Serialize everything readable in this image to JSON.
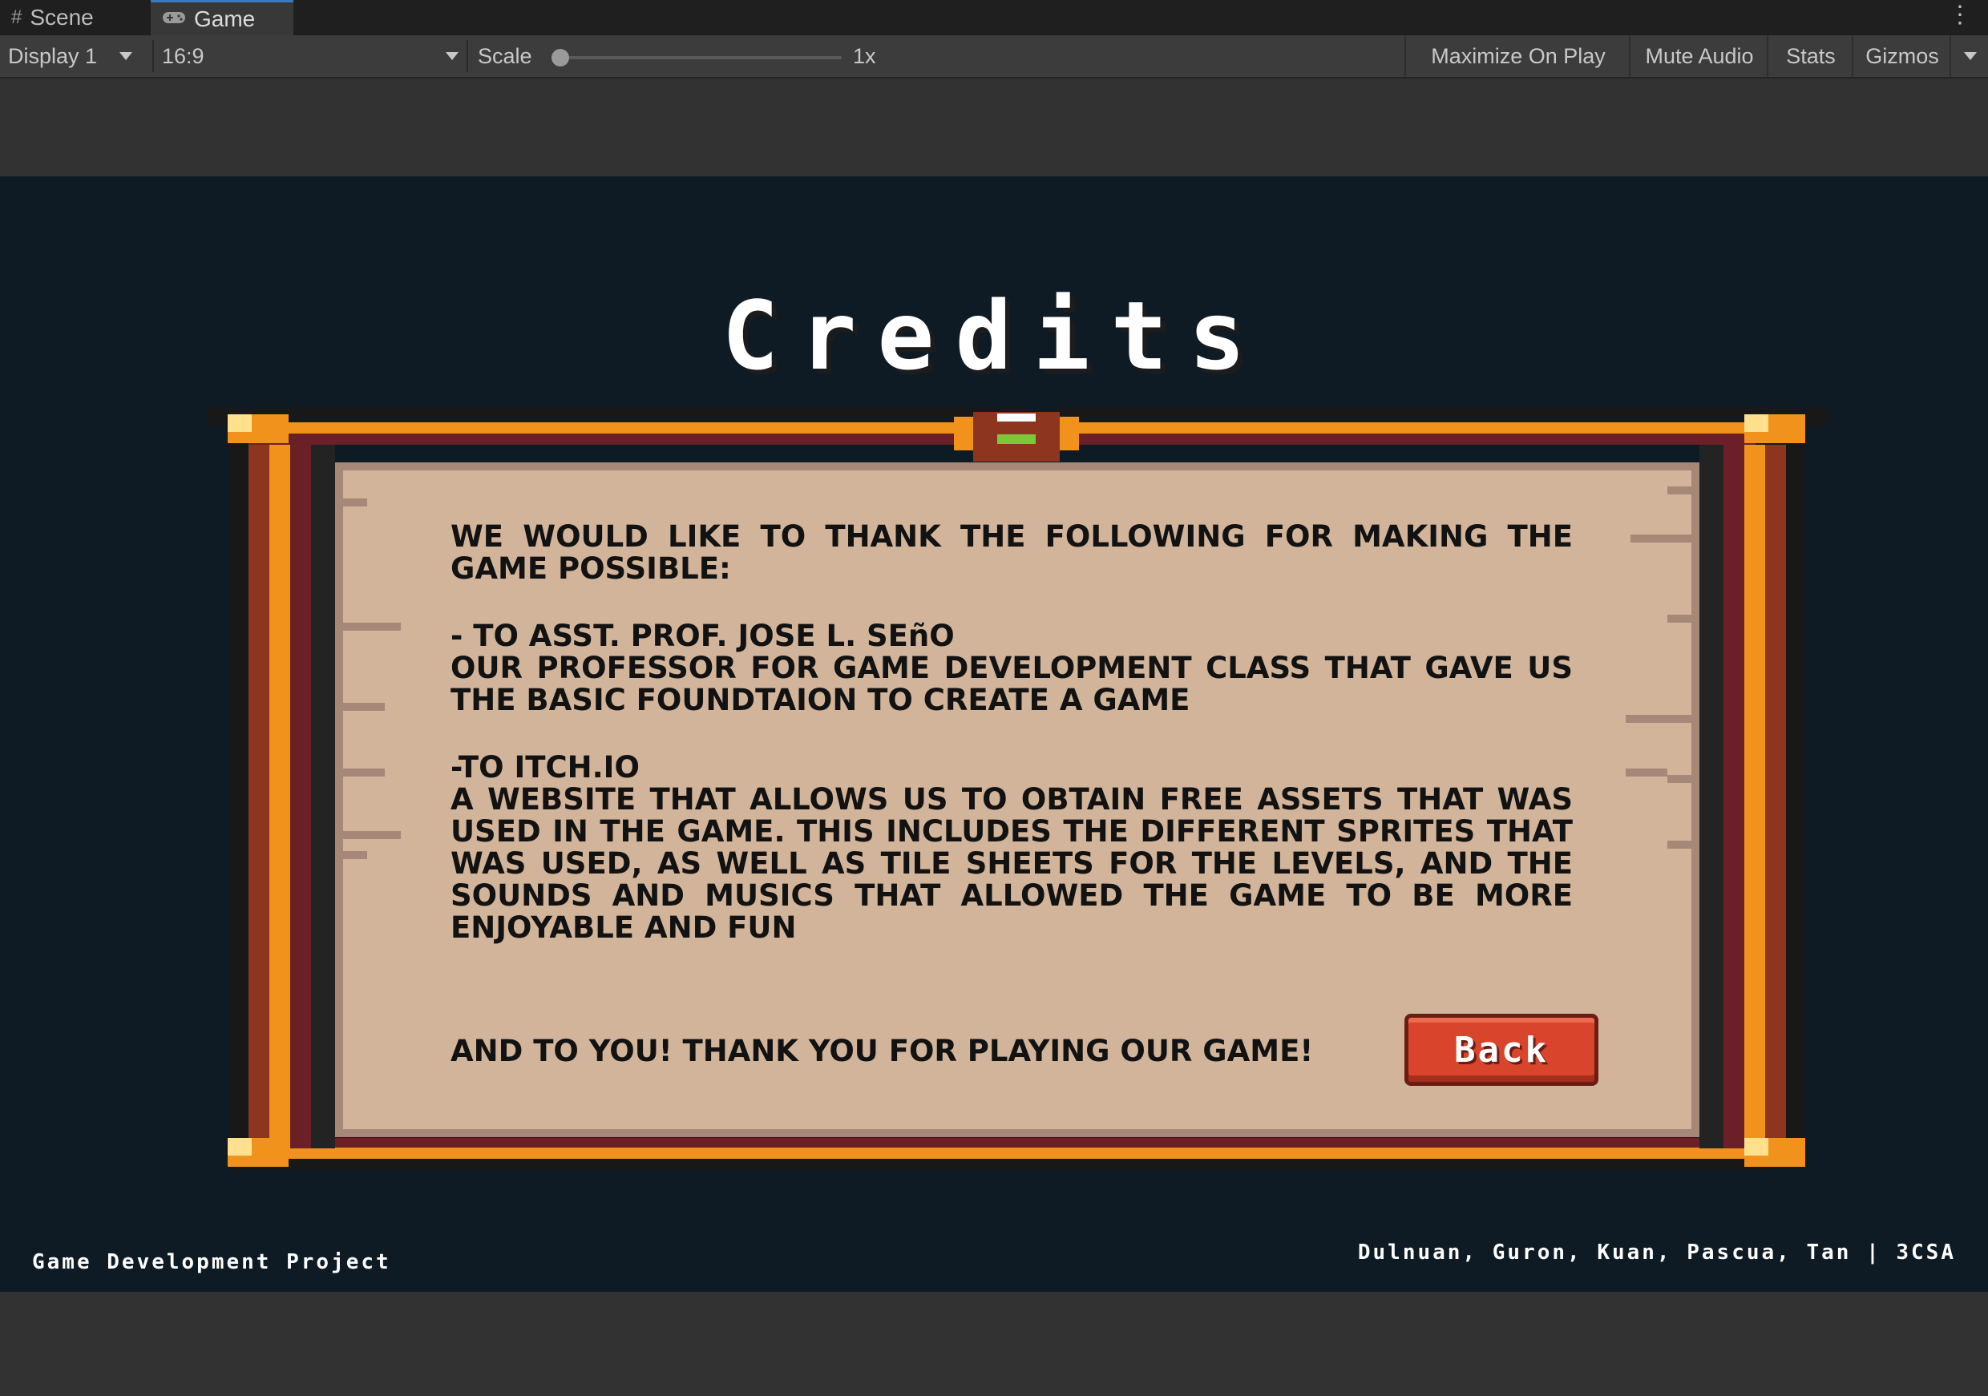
{
  "tabs": [
    {
      "label": "Scene",
      "icon": "grid-icon"
    },
    {
      "label": "Game",
      "icon": "gamepad-icon"
    }
  ],
  "toolbar": {
    "display": "Display 1",
    "aspect": "16:9",
    "scale_label": "Scale",
    "scale_value": "1x",
    "maximize": "Maximize On Play",
    "mute": "Mute Audio",
    "stats": "Stats",
    "gizmos": "Gizmos"
  },
  "game": {
    "title": "Credits",
    "intro": "WE WOULD LIKE TO THANK THE FOLLOWING FOR MAKING THE GAME POSSIBLE:",
    "credit1_heading": "- TO ASST. PROF. JOSE L. SEñO",
    "credit1_body": "OUR PROFESSOR FOR GAME DEVELOPMENT CLASS THAT GAVE US THE BASIC FOUNDTAION TO CREATE A GAME",
    "credit2_heading": "-TO ITCH.IO",
    "credit2_body": "A WEBSITE THAT ALLOWS US TO OBTAIN FREE ASSETS THAT WAS USED IN THE GAME. THIS INCLUDES THE DIFFERENT SPRITES THAT WAS USED, AS WELL AS TILE SHEETS FOR THE LEVELS, AND THE SOUNDS AND MUSICS THAT ALLOWED THE GAME TO BE MORE ENJOYABLE AND FUN",
    "closing": "AND TO YOU! THANK YOU FOR PLAYING OUR GAME!",
    "back_label": "Back",
    "footer_left": "Game Development Project",
    "footer_right": "Dulnuan, Guron, Kuan, Pascua, Tan | 3CSA"
  },
  "colors": {
    "frame_orange": "#f1921c",
    "frame_dark_red": "#6b1f27",
    "paper": "#d2b49a",
    "button": "#d9442d",
    "game_bg": "#0f1b24"
  }
}
